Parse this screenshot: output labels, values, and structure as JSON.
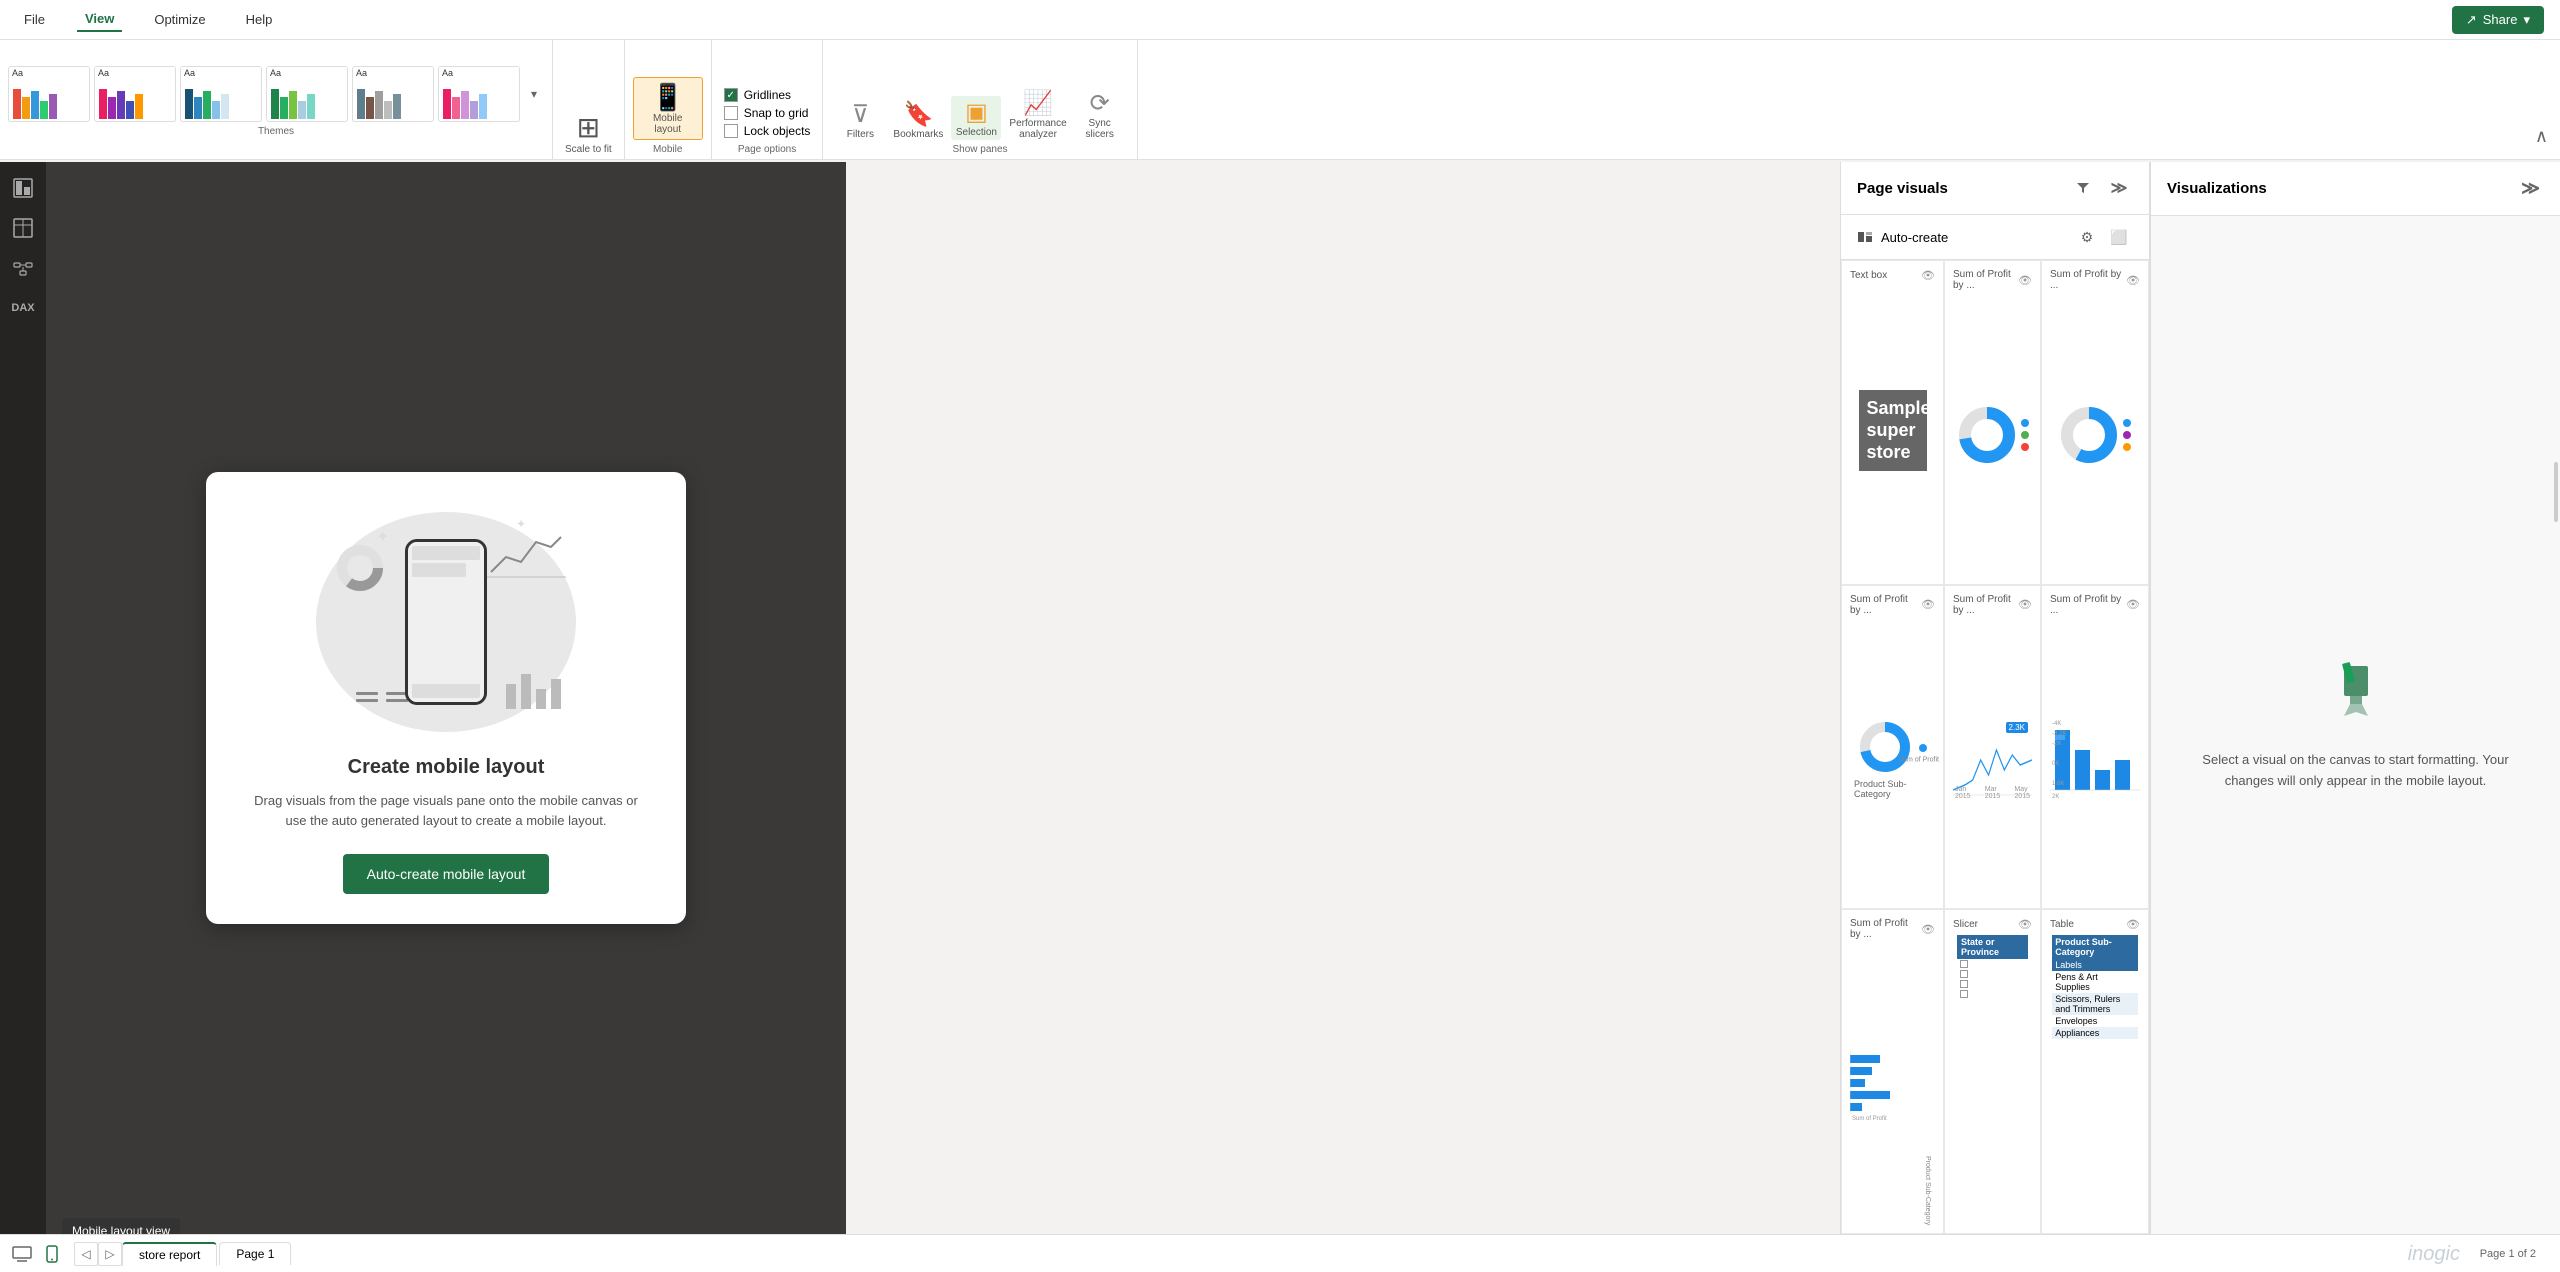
{
  "titleBar": {
    "menus": [
      "File",
      "View",
      "Optimize",
      "Help"
    ],
    "activeMenu": "View",
    "shareBtn": "Share"
  },
  "ribbon": {
    "themesLabel": "Themes",
    "themes": [
      {
        "label": "Aa",
        "colors": [
          "#e74c3c",
          "#3498db",
          "#2ecc71",
          "#f39c12",
          "#9b59b6"
        ]
      },
      {
        "label": "Aa",
        "colors": [
          "#e91e63",
          "#9c27b0",
          "#673ab7",
          "#3f51b5",
          "#2196f3"
        ]
      },
      {
        "label": "Aa",
        "colors": [
          "#1a5276",
          "#2e86c1",
          "#27ae60",
          "#d4e6f1",
          "#85c1e9"
        ]
      },
      {
        "label": "Aa",
        "colors": [
          "#1e8449",
          "#2e7d32",
          "#33691e",
          "#558b2f",
          "#76c442"
        ]
      },
      {
        "label": "Aa",
        "colors": [
          "#607d8b",
          "#795548",
          "#9e9e9e",
          "#bdbdbd",
          "#78909c"
        ]
      },
      {
        "label": "Aa",
        "colors": [
          "#e91e63",
          "#f06292",
          "#ce93d8",
          "#b39ddb",
          "#90caf9"
        ]
      }
    ],
    "scaleToFit": "Scale to fit",
    "mobile": {
      "label": "Mobile\nlayout",
      "active": true
    },
    "mobileLabel": "Mobile",
    "pageOptions": {
      "label": "Page options",
      "items": [
        {
          "label": "Gridlines",
          "checked": true
        },
        {
          "label": "Snap to grid",
          "checked": false
        },
        {
          "label": "Lock objects",
          "checked": false
        }
      ]
    },
    "showPanes": {
      "label": "Show panes",
      "items": [
        {
          "label": "Filters",
          "icon": "▽"
        },
        {
          "label": "Bookmarks",
          "icon": "🔖"
        },
        {
          "label": "Selection",
          "icon": "⬜",
          "active": true
        },
        {
          "label": "Performance\nanalyzer",
          "icon": "📊"
        },
        {
          "label": "Sync\nslicers",
          "icon": "⟳"
        }
      ]
    }
  },
  "leftSidebar": {
    "icons": [
      {
        "name": "report-view",
        "icon": "▤"
      },
      {
        "name": "table-view",
        "icon": "⊞"
      },
      {
        "name": "model-view",
        "icon": "⬡"
      },
      {
        "name": "dax-query",
        "icon": "fx"
      }
    ]
  },
  "mobileCanvas": {
    "title": "Create mobile layout",
    "description": "Drag visuals from the page visuals pane onto the mobile canvas or use the auto generated layout to create a mobile layout.",
    "buttonLabel": "Auto-create mobile layout"
  },
  "tooltip": {
    "text": "Mobile layout view"
  },
  "bottomBar": {
    "currentPage": "Page 1 of 2",
    "tabs": [
      "store report",
      "Page 1"
    ],
    "activeTab": "store report"
  },
  "pageVisuals": {
    "title": "Page visuals",
    "autoCreate": "Auto-create",
    "visuals": [
      {
        "label": "Text box",
        "type": "textbox"
      },
      {
        "label": "Sum of Profit by ...",
        "type": "donut1"
      },
      {
        "label": "Sum of Profit by ...",
        "type": "donut2"
      },
      {
        "label": "Sum of Profit by ...",
        "type": "donut3"
      },
      {
        "label": "Sum of Profit by ...",
        "type": "linechart"
      },
      {
        "label": "Sum of Profit by ...",
        "type": "barchart"
      },
      {
        "label": "Sum of Profit by ...",
        "type": "bargrouped"
      },
      {
        "label": "Slicer",
        "type": "slicer"
      },
      {
        "label": "Table",
        "type": "table"
      }
    ]
  },
  "visualizations": {
    "title": "Visualizations",
    "emptyText": "Select a visual on the canvas to start formatting. Your changes will only appear in the mobile layout."
  },
  "table": {
    "header": "Product Sub-Category",
    "rows": [
      "Labels",
      "Pens & Art Supplies",
      "Scissors, Rulers and Trimmers",
      "Envelopes",
      "Appliances"
    ]
  },
  "slicer": {
    "header": "State or Province",
    "rows": [
      "",
      "",
      "",
      ""
    ]
  }
}
